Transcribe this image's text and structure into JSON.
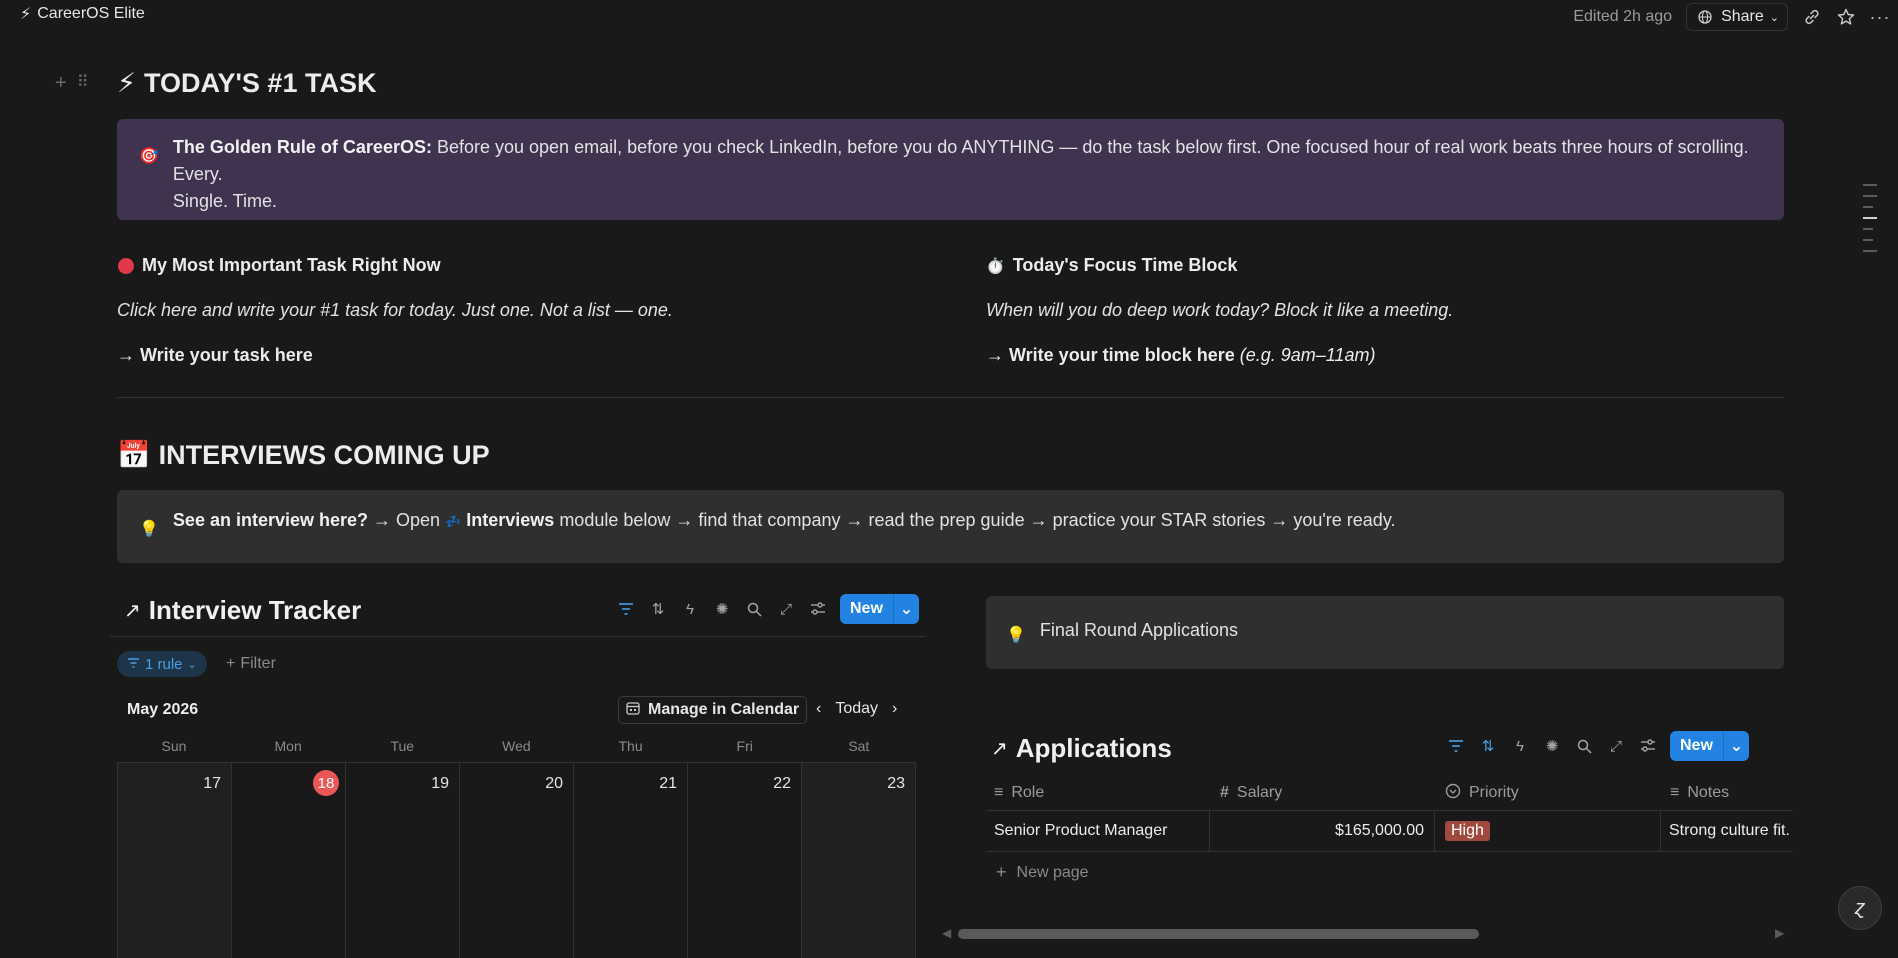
{
  "topbar": {
    "breadcrumb_icon": "⚡",
    "breadcrumb": "CareerOS Elite",
    "edited": "Edited 2h ago",
    "share": "Share"
  },
  "task_section": {
    "icon": "⚡",
    "title": "TODAY'S #1 TASK",
    "callout": {
      "icon": "🎯",
      "bold": "The Golden Rule of CareerOS:",
      "text_line1": " Before you open email, before you check LinkedIn, before you do ANYTHING — do the task below first. One focused hour of real work beats three hours of scrolling. Every.",
      "text_line2": "Single. Time.",
      "color": "#3f3350"
    },
    "left": {
      "icon": "🔴",
      "heading": "My Most Important Task Right Now",
      "italic": "Click here and write your #1 task for today. Just one. Not a list — one.",
      "action": "→ Write your task here"
    },
    "right": {
      "icon": "⏱️",
      "heading": "Today's Focus Time Block",
      "italic": "When will you do deep work today? Block it like a meeting.",
      "action": "→ Write your time block here",
      "action_hint": "(e.g. 9am–11am)"
    }
  },
  "interviews_section": {
    "icon": "📅",
    "title": "INTERVIEWS COMING UP",
    "callout": {
      "icon": "💡",
      "bold1": "See an interview here?",
      "text1": " → Open ",
      "inline_icon": "💤",
      "bold2": "Interviews",
      "text2": " module below → find that company → read the prep guide → practice your STAR stories → you're ready.",
      "color": "#2f2f2f"
    }
  },
  "interview_tracker": {
    "arrow": "↗",
    "title": "Interview Tracker",
    "new_label": "New",
    "rule_chip": "1 rule",
    "filter_label": "Filter",
    "month": "May 2026",
    "manage_calendar": "Manage in Calendar",
    "today": "Today",
    "weekdays": [
      "Sun",
      "Mon",
      "Tue",
      "Wed",
      "Thu",
      "Fri",
      "Sat"
    ],
    "days": [
      "17",
      "18",
      "19",
      "20",
      "21",
      "22",
      "23"
    ],
    "today_index": 1
  },
  "final_round": {
    "icon": "💡",
    "text": "Final Round Applications"
  },
  "applications": {
    "arrow": "↗",
    "title": "Applications",
    "new_label": "New",
    "columns": {
      "role": "Role",
      "salary": "Salary",
      "priority": "Priority",
      "notes": "Notes"
    },
    "row": {
      "role": "Senior Product Manager",
      "salary": "$165,000.00",
      "priority": "High",
      "notes": "Strong culture fit."
    },
    "new_page": "New page"
  },
  "colors": {
    "accent": "#2383e2",
    "today_red": "#eb5757",
    "priority_high": "#a04a3f"
  }
}
